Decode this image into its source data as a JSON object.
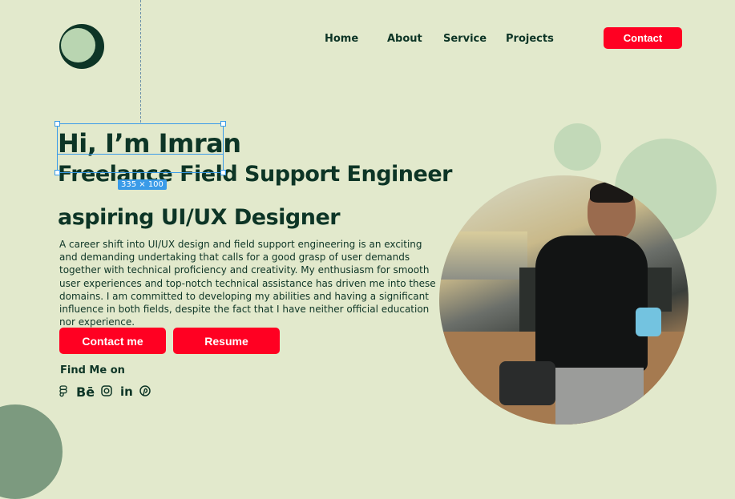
{
  "nav": {
    "items": [
      "Home",
      "About",
      "Service",
      "Projects"
    ],
    "contact": "Contact"
  },
  "hero": {
    "greeting": "Hi, I’m Imran",
    "line1": "Freelance Field Support Engineer",
    "line2": "aspiring UI/UX Designer",
    "description": "A career shift into UI/UX design and field support engineering is an exciting and demanding undertaking that calls for a good grasp of user demands together with technical proficiency and creativity. My enthusiasm for smooth user experiences and top-notch technical assistance has driven me into these domains. I am committed to developing my abilities and having a significant influence in both fields, despite the fact that I have neither official education nor experience.",
    "contact_button": "Contact me",
    "resume_button": "Resume"
  },
  "selection": {
    "size_label": "335 × 100"
  },
  "social": {
    "heading": "Find Me on",
    "icons": [
      "figma-icon",
      "behance-icon",
      "instagram-icon",
      "linkedin-icon",
      "pinterest-icon"
    ],
    "behance_text": "Bē",
    "linkedin_text": "in"
  },
  "colors": {
    "background": "#e2e9cc",
    "primary": "#0d3526",
    "accent": "#ff0022",
    "selection": "#3a9be8"
  }
}
